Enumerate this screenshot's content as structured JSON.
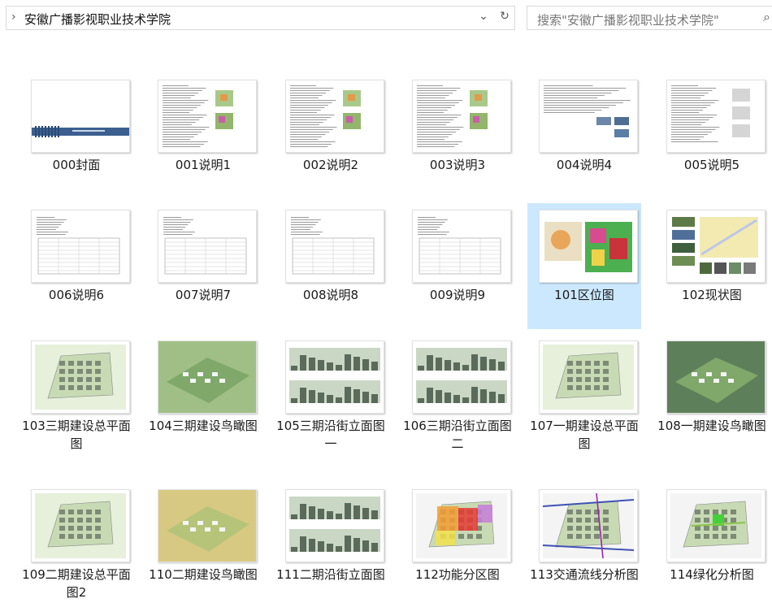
{
  "address_bar": {
    "path": "安徽广播影视职业技术学院"
  },
  "search": {
    "placeholder": "搜索\"安徽广播影视职业技术学院\""
  },
  "files": [
    {
      "name": "000封面",
      "thumb": "cover"
    },
    {
      "name": "001说明1",
      "thumb": "text-map"
    },
    {
      "name": "002说明2",
      "thumb": "text-map"
    },
    {
      "name": "003说明3",
      "thumb": "text-map"
    },
    {
      "name": "004说明4",
      "thumb": "text-photo"
    },
    {
      "name": "005说明5",
      "thumb": "text-gray"
    },
    {
      "name": "006说明6",
      "thumb": "table"
    },
    {
      "name": "007说明7",
      "thumb": "table"
    },
    {
      "name": "008说明8",
      "thumb": "table"
    },
    {
      "name": "009说明9",
      "thumb": "table"
    },
    {
      "name": "101区位图",
      "thumb": "location",
      "selected": true
    },
    {
      "name": "102现状图",
      "thumb": "photos"
    },
    {
      "name": "103三期建设总平面图",
      "thumb": "plan"
    },
    {
      "name": "104三期建设鸟瞰图",
      "thumb": "aerial"
    },
    {
      "name": "105三期沿街立面图一",
      "thumb": "elevation"
    },
    {
      "name": "106三期沿街立面图二",
      "thumb": "elevation"
    },
    {
      "name": "107一期建设总平面图",
      "thumb": "plan"
    },
    {
      "name": "108一期建设鸟瞰图",
      "thumb": "aerial-dark"
    },
    {
      "name": "109二期建设总平面图2",
      "thumb": "plan"
    },
    {
      "name": "110二期建设鸟瞰图",
      "thumb": "aerial-yellow"
    },
    {
      "name": "111二期沿街立面图",
      "thumb": "elevation"
    },
    {
      "name": "112功能分区图",
      "thumb": "zones"
    },
    {
      "name": "113交通流线分析图",
      "thumb": "traffic"
    },
    {
      "name": "114绿化分析图",
      "thumb": "green"
    }
  ]
}
